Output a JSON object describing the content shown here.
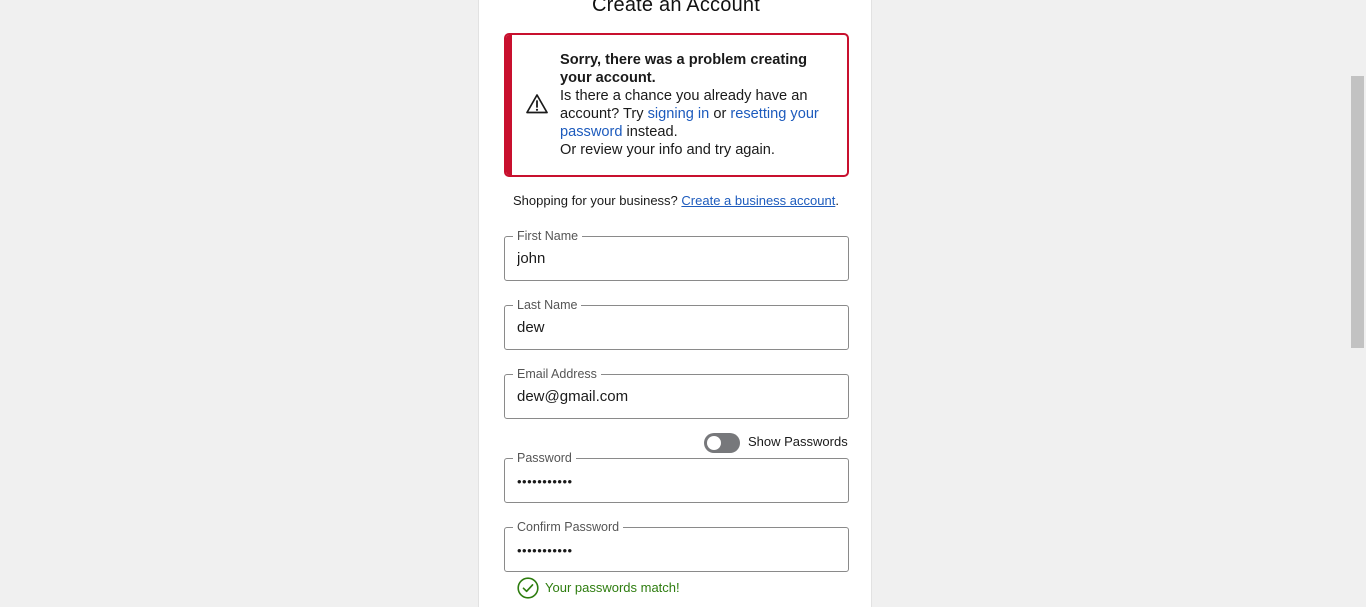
{
  "page": {
    "title": "Create an Account"
  },
  "alert": {
    "heading": "Sorry, there was a problem creating your account.",
    "line1_pre": "Is there a chance you already have an account? Try ",
    "signin_link": "signing in",
    "line1_mid": " or ",
    "reset_link": "resetting your password",
    "line1_post": " instead.",
    "line2": "Or review your info and try again.",
    "icon": "warning-triangle-icon",
    "accent_color": "#c8102e"
  },
  "business": {
    "prompt": "Shopping for your business? ",
    "link": "Create a business account",
    "suffix": "."
  },
  "form": {
    "first_name": {
      "label": "First Name",
      "value": "john"
    },
    "last_name": {
      "label": "Last Name",
      "value": "dew"
    },
    "email": {
      "label": "Email Address",
      "value": "dew@gmail.com"
    },
    "show_passwords": {
      "label": "Show Passwords",
      "enabled": false
    },
    "password": {
      "label": "Password",
      "masked": "•••••••••••"
    },
    "confirm_password": {
      "label": "Confirm Password",
      "masked": "•••••••••••"
    },
    "match_message": "Your passwords match!"
  },
  "colors": {
    "link": "#1d5bbd",
    "success": "#2e7d0f",
    "error": "#c8102e"
  }
}
